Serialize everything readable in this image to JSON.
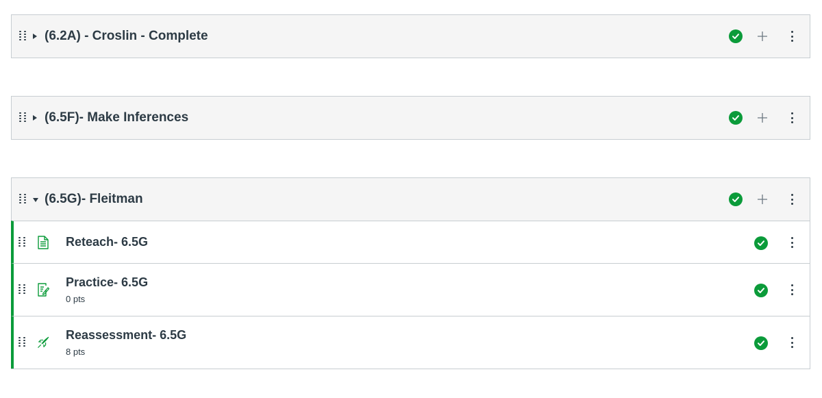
{
  "colors": {
    "published": "#0b9b3a",
    "border": "#c7cdd1",
    "header_bg": "#f5f5f5",
    "text": "#2d3b45"
  },
  "modules": [
    {
      "title": "(6.2A) - Croslin - Complete",
      "expanded": false,
      "icons": [
        "drag-handle-icon",
        "caret-right-icon",
        "published-check-icon",
        "plus-icon",
        "kebab-menu-icon"
      ]
    },
    {
      "title": "(6.5F)- Make Inferences",
      "expanded": false,
      "icons": [
        "drag-handle-icon",
        "caret-right-icon",
        "published-check-icon",
        "plus-icon",
        "kebab-menu-icon"
      ]
    },
    {
      "title": "(6.5G)- Fleitman",
      "expanded": true,
      "icons": [
        "drag-handle-icon",
        "caret-down-icon",
        "published-check-icon",
        "plus-icon",
        "kebab-menu-icon"
      ],
      "items": [
        {
          "title": "Reteach- 6.5G",
          "points": "",
          "icon": "page-document-icon"
        },
        {
          "title": "Practice- 6.5G",
          "points": "0 pts",
          "icon": "assignment-icon"
        },
        {
          "title": "Reassessment- 6.5G",
          "points": "8 pts",
          "icon": "quiz-rocket-icon"
        }
      ]
    }
  ]
}
